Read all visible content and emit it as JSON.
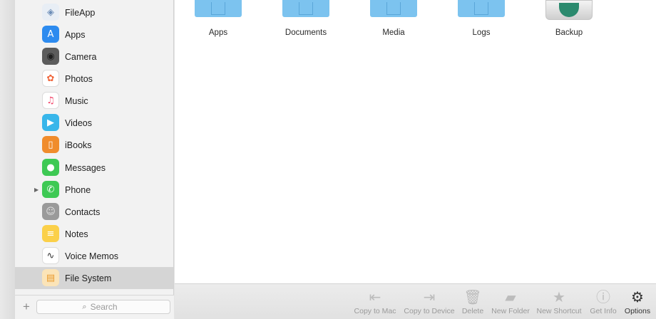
{
  "sidebar": {
    "items": [
      {
        "label": "FileApp",
        "icon": "fileapp-icon",
        "color": "#e8eef5",
        "glyph": "◈",
        "glyph_color": "#6b8db7"
      },
      {
        "label": "Apps",
        "icon": "app-store-icon",
        "color": "#2d8bef",
        "glyph": "A",
        "glyph_color": "#ffffff"
      },
      {
        "label": "Camera",
        "icon": "camera-icon",
        "color": "#5c5c5c",
        "glyph": "◉",
        "glyph_color": "#1f1f1f"
      },
      {
        "label": "Photos",
        "icon": "photos-icon",
        "color": "#ffffff",
        "glyph": "✿",
        "glyph_color": "#f0653a"
      },
      {
        "label": "Music",
        "icon": "music-icon",
        "color": "#ffffff",
        "glyph": "♫",
        "glyph_color": "#f2466a"
      },
      {
        "label": "Videos",
        "icon": "videos-icon",
        "color": "#38b6ea",
        "glyph": "▶",
        "glyph_color": "#ffffff"
      },
      {
        "label": "iBooks",
        "icon": "ibooks-icon",
        "color": "#f08c2c",
        "glyph": "▯",
        "glyph_color": "#ffffff"
      },
      {
        "label": "Messages",
        "icon": "messages-icon",
        "color": "#3ec954",
        "glyph": "●",
        "glyph_color": "#ffffff"
      },
      {
        "label": "Phone",
        "icon": "phone-icon",
        "color": "#3ec954",
        "glyph": "✆",
        "glyph_color": "#ffffff",
        "expandable": true
      },
      {
        "label": "Contacts",
        "icon": "contacts-icon",
        "color": "#9a9a9a",
        "glyph": "☺",
        "glyph_color": "#e2e2e2"
      },
      {
        "label": "Notes",
        "icon": "notes-icon",
        "color": "#fbd049",
        "glyph": "≡",
        "glyph_color": "#ffffff"
      },
      {
        "label": "Voice Memos",
        "icon": "voice-memos-icon",
        "color": "#ffffff",
        "glyph": "∿",
        "glyph_color": "#333333"
      },
      {
        "label": "File System",
        "icon": "file-system-icon",
        "color": "#fbe4b8",
        "glyph": "▤",
        "glyph_color": "#e89a2e",
        "selected": true
      }
    ],
    "add_label": "+",
    "search_placeholder": "Search"
  },
  "main": {
    "folders": [
      {
        "name": "Apps",
        "icon": "apps-folder-icon"
      },
      {
        "name": "Documents",
        "icon": "documents-folder-icon"
      },
      {
        "name": "Media",
        "icon": "media-folder-icon"
      },
      {
        "name": "Logs",
        "icon": "logs-folder-icon"
      },
      {
        "name": "Backup",
        "icon": "backup-drive-icon"
      }
    ]
  },
  "toolbar": {
    "buttons": [
      {
        "label": "Copy to Mac",
        "icon": "copy-to-mac-icon",
        "glyph": "⇤"
      },
      {
        "label": "Copy to Device",
        "icon": "copy-to-device-icon",
        "glyph": "⇥"
      },
      {
        "label": "Delete",
        "icon": "trash-icon",
        "glyph": "🗑"
      },
      {
        "label": "New Folder",
        "icon": "new-folder-icon",
        "glyph": "▰"
      },
      {
        "label": "New Shortcut",
        "icon": "star-icon",
        "glyph": "★"
      },
      {
        "label": "Get Info",
        "icon": "info-icon",
        "glyph": "ⓘ"
      },
      {
        "label": "Options",
        "icon": "gear-icon",
        "glyph": "⚙",
        "active": true
      }
    ]
  }
}
